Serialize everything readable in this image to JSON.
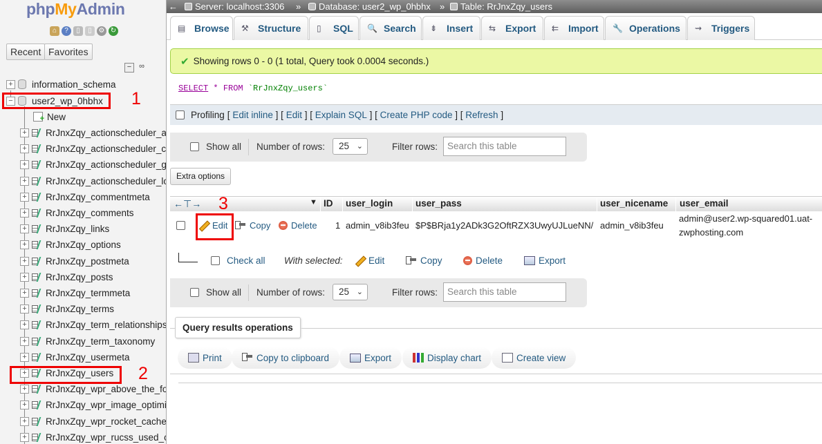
{
  "app": {
    "logo_php": "php",
    "logo_my": "My",
    "logo_admin": "Admin",
    "recent_label": "Recent",
    "favorites_label": "Favorites"
  },
  "sidebar": {
    "databases": [
      {
        "name": "information_schema",
        "expanded": false
      },
      {
        "name": "user2_wp_0hbhx",
        "expanded": true
      }
    ],
    "new_label": "New",
    "tables": [
      "RrJnxZqy_actionscheduler_a",
      "RrJnxZqy_actionscheduler_cl",
      "RrJnxZqy_actionscheduler_g",
      "RrJnxZqy_actionscheduler_lo",
      "RrJnxZqy_commentmeta",
      "RrJnxZqy_comments",
      "RrJnxZqy_links",
      "RrJnxZqy_options",
      "RrJnxZqy_postmeta",
      "RrJnxZqy_posts",
      "RrJnxZqy_termmeta",
      "RrJnxZqy_terms",
      "RrJnxZqy_term_relationships",
      "RrJnxZqy_term_taxonomy",
      "RrJnxZqy_usermeta",
      "RrJnxZqy_users",
      "RrJnxZqy_wpr_above_the_fo",
      "RrJnxZqy_wpr_image_optimi",
      "RrJnxZqy_wpr_rocket_cache",
      "RrJnxZqy_wpr_rucss_used_c"
    ]
  },
  "annotations": {
    "label1": "1",
    "label2": "2",
    "label3": "3",
    "color": "#e00000"
  },
  "breadcrumb": {
    "arrow": "←",
    "server": "Server: localhost:3306",
    "database": "Database: user2_wp_0hbhx",
    "table": "Table: RrJnxZqy_users",
    "sep": "»"
  },
  "tabs": [
    {
      "label": "Browse",
      "icon": "browse-icon",
      "active": true
    },
    {
      "label": "Structure",
      "icon": "structure-icon"
    },
    {
      "label": "SQL",
      "icon": "sql-icon"
    },
    {
      "label": "Search",
      "icon": "search-icon"
    },
    {
      "label": "Insert",
      "icon": "insert-icon"
    },
    {
      "label": "Export",
      "icon": "export-icon"
    },
    {
      "label": "Import",
      "icon": "import-icon"
    },
    {
      "label": "Operations",
      "icon": "operations-icon"
    },
    {
      "label": "Triggers",
      "icon": "triggers-icon"
    }
  ],
  "message": {
    "success": "Showing rows 0 - 0 (1 total, Query took 0.0004 seconds.)"
  },
  "sql": {
    "select": "SELECT",
    "star": "*",
    "from": "FROM",
    "table": "`RrJnxZqy_users`"
  },
  "profiling": {
    "label": "Profiling",
    "edit_inline": "Edit inline",
    "edit": "Edit",
    "explain": "Explain SQL",
    "create_php": "Create PHP code",
    "refresh": "Refresh",
    "lb": "[",
    "rb": "]"
  },
  "nav": {
    "show_all": "Show all",
    "rows_label": "Number of rows:",
    "rows_value": "25",
    "filter_label": "Filter rows:",
    "filter_placeholder": "Search this table"
  },
  "extra_options": "Extra options",
  "table": {
    "columns": [
      "ID",
      "user_login",
      "user_pass",
      "user_nicename",
      "user_email"
    ],
    "row": {
      "edit": "Edit",
      "copy": "Copy",
      "delete": "Delete",
      "id": "1",
      "user_login": "admin_v8ib3feu",
      "user_pass": "$P$BRja1y2ADk3G2OftRZX3UwyUJLueNN/",
      "user_nicename": "admin_v8ib3feu",
      "user_email_1": "admin@user2.wp-squared01.uat-",
      "user_email_2": "zwphosting.com"
    }
  },
  "bulk": {
    "check_all": "Check all",
    "with_selected": "With selected:",
    "edit": "Edit",
    "copy": "Copy",
    "delete": "Delete",
    "export": "Export"
  },
  "query_ops": {
    "title": "Query results operations",
    "print": "Print",
    "copy_clipboard": "Copy to clipboard",
    "export": "Export",
    "display_chart": "Display chart",
    "create_view": "Create view"
  }
}
